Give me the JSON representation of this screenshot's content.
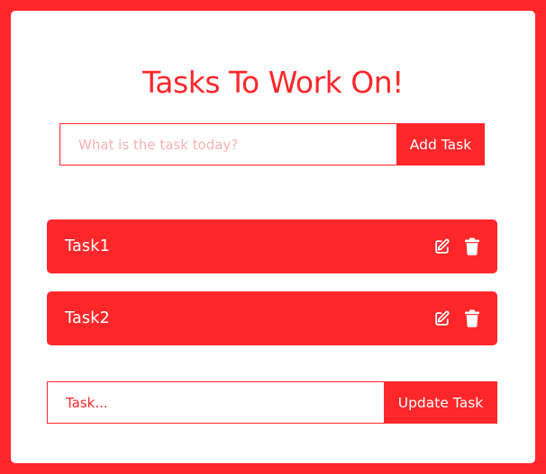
{
  "app": {
    "title": "Tasks To Work On!",
    "accent_color": "#ff272a",
    "background_color": "#ffffff"
  },
  "add_form": {
    "placeholder": "What is the task today?",
    "value": "",
    "button_label": "Add Task"
  },
  "tasks": [
    {
      "label": "Task1",
      "edit_icon": "edit-icon",
      "delete_icon": "trash-icon"
    },
    {
      "label": "Task2",
      "edit_icon": "edit-icon",
      "delete_icon": "trash-icon"
    }
  ],
  "update_form": {
    "placeholder": "Task...",
    "value": "",
    "button_label": "Update Task"
  }
}
